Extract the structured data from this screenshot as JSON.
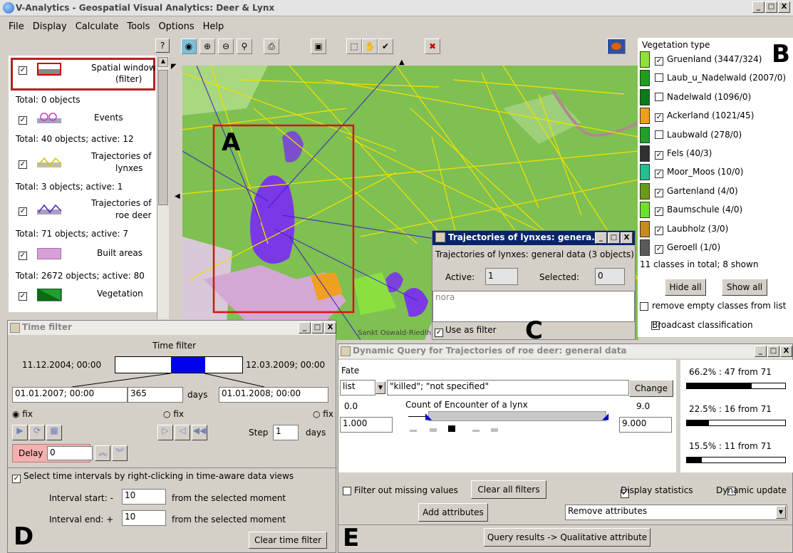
{
  "window": {
    "title": "V-Analytics - Geospatial Visual Analytics: Deer & Lynx",
    "min": "_",
    "max": "□",
    "close": "X"
  },
  "menu": [
    "File",
    "Display",
    "Calculate",
    "Tools",
    "Options",
    "Help"
  ],
  "help_btn": "?",
  "layers": {
    "spatial_window": "Spatial window",
    "spatial_window_sub": "(filter)",
    "total0": "Total: 0 objects",
    "events": "Events",
    "total_events": "Total: 40 objects; active: 12",
    "traj_lynx_1": "Trajectories of",
    "traj_lynx_2": "lynxes",
    "total_lynx": "Total: 3 objects; active: 1",
    "traj_deer_1": "Trajectories of",
    "traj_deer_2": "roe deer",
    "total_deer": "Total: 71 objects; active: 7",
    "built": "Built areas",
    "total_built": "Total: 2672 objects; active: 80",
    "vegetation": "Vegetation"
  },
  "map": {
    "place_label": "Sankt Oswald-Riedlhü"
  },
  "labels": {
    "A": "A",
    "B": "B",
    "C": "C",
    "D": "D",
    "E": "E"
  },
  "legend": {
    "title": "Vegetation type",
    "items": [
      {
        "label": "Gruenland (3447/324)",
        "checked": true,
        "color": "#8fe23a"
      },
      {
        "label": "Laub_u_Nadelwald (2007/0)",
        "checked": false,
        "color": "#1e9e1e"
      },
      {
        "label": "Nadelwald (1096/0)",
        "checked": false,
        "color": "#0c7a18"
      },
      {
        "label": "Ackerland (1021/45)",
        "checked": true,
        "color": "#f0a020"
      },
      {
        "label": "Laubwald (278/0)",
        "checked": false,
        "color": "#22a028"
      },
      {
        "label": "Fels (40/3)",
        "checked": true,
        "color": "#303030"
      },
      {
        "label": "Moor_Moos (10/0)",
        "checked": true,
        "color": "#20c090"
      },
      {
        "label": "Gartenland (4/0)",
        "checked": true,
        "color": "#6a9a1a"
      },
      {
        "label": "Baumschule (4/0)",
        "checked": true,
        "color": "#70e030"
      },
      {
        "label": "Laubholz (3/0)",
        "checked": true,
        "color": "#c88a20"
      },
      {
        "label": "Geroell (1/0)",
        "checked": true,
        "color": "#5a5a5a"
      }
    ],
    "summary": "11 classes in total;  8 shown",
    "hide_all": "Hide all",
    "show_all": "Show all",
    "remove_empty": "remove empty classes from list",
    "broadcast": "Broadcast classification"
  },
  "lynx_dialog": {
    "title": "Trajectories of lynxes: genera...",
    "heading": "Trajectories of lynxes: general data (3 objects)",
    "active_label": "Active:",
    "active_value": "1",
    "selected_label": "Selected:",
    "selected_value": "0",
    "list_item": "nora",
    "use_as_filter": "Use as filter"
  },
  "time_filter": {
    "title": "Time filter",
    "heading": "Time filter",
    "start": "11.12.2004; 00:00",
    "end": "12.03.2009; 00:00",
    "from": "01.01.2007; 00:00",
    "days_value": "365",
    "days_label": "days",
    "to": "01.01.2008; 00:00",
    "fix": "fix",
    "step_label": "Step",
    "step_value": "1",
    "delay_label": "Delay",
    "delay_value": "0",
    "select_intervals": "Select time intervals by right-clicking in time-aware data views",
    "interval_start": "Interval start: -",
    "interval_start_value": "10",
    "interval_end": "Interval end: +",
    "interval_end_value": "10",
    "from_selected": "from the selected moment",
    "clear": "Clear time filter"
  },
  "dyn_query": {
    "title": "Dynamic Query for Trajectories of roe deer: general data",
    "fate_label": "Fate",
    "list_value": "list",
    "fate_value": "\"killed\"; \"not specified\"",
    "change": "Change",
    "range_min": "0.0",
    "range_max": "9.0",
    "attr_label": "Count of Encounter of a lynx",
    "low_value": "1.000",
    "high_value": "9.000",
    "filter_missing": "Filter out missing values",
    "clear_all": "Clear all filters",
    "display_stats": "Display statistics",
    "dynamic_update": "Dynamic update",
    "add_attrs": "Add attributes",
    "remove_attrs": "Remove attributes",
    "query_results": "Query results -> Qualitative attribute",
    "stats": [
      {
        "text": "66.2% : 47 from 71",
        "fraction": 0.662
      },
      {
        "text": "22.5% : 16 from 71",
        "fraction": 0.225
      },
      {
        "text": "15.5% : 11 from 71",
        "fraction": 0.155
      }
    ]
  }
}
